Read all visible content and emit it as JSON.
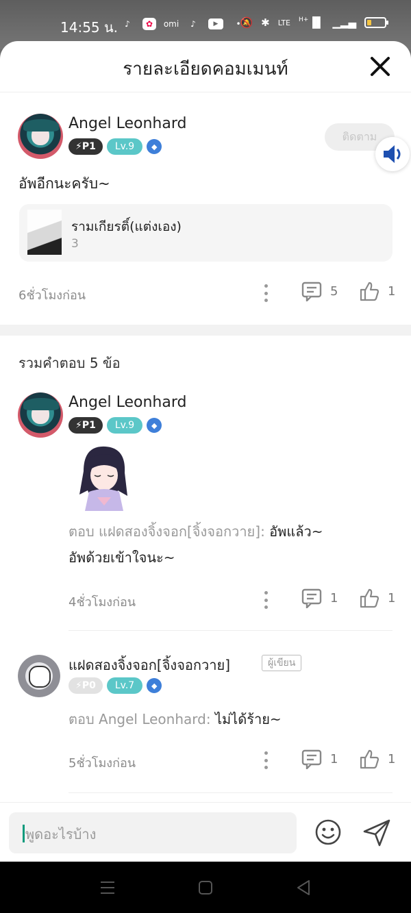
{
  "status_bar": {
    "time": "14:55 น.",
    "app_icons": [
      "music-icon",
      "photos-icon",
      "omi-icon",
      "tiktok-icon",
      "youtube-icon",
      "dot-icon"
    ],
    "omi_label": "omi",
    "network_label": "LTE",
    "net_top": "H+"
  },
  "header": {
    "title": "รายละเอียดคอมเมนท์"
  },
  "post": {
    "user": "Angel Leonhard",
    "badge_p": "P1",
    "badge_lv": "Lv.9",
    "follow_label": "ติดตาม",
    "text": "อัพอีกนะครับ~",
    "quote": {
      "title": "รามเกียรติ์(แต่งเอง)",
      "count": "3"
    },
    "time": "6ชั่วโมงก่อน",
    "comment_count": "5",
    "like_count": "1"
  },
  "replies_title": "รวมคำตอบ 5 ข้อ",
  "replies": [
    {
      "user": "Angel Leonhard",
      "badge_p": "P1",
      "badge_lv": "Lv.9",
      "reply_prefix": "ตอบ แฝดสองจิ้งจอก[จิ้งจอกวาย]: ",
      "reply_text": "อัพแล้ว~",
      "reply_line2": "อัพด้วยเข้าใจนะ~",
      "time": "4ชั่วโมงก่อน",
      "comment_count": "1",
      "like_count": "1"
    },
    {
      "user": "แฝดสองจิ้งจอก[จิ้งจอกวาย]",
      "author_tag": "ผู้เขียน",
      "badge_p": "P0",
      "badge_lv": "Lv.7",
      "reply_prefix": "ตอบ Angel Leonhard: ",
      "reply_text": "ไม่ได้ร้าย~",
      "time": "5ชั่วโมงก่อน",
      "comment_count": "1",
      "like_count": "1"
    }
  ],
  "input": {
    "placeholder": "พูดอะไรบ้าง"
  },
  "colors": {
    "level_badge": "#5bc7c8",
    "gem": "#3e7fd9",
    "caret": "#0a9a7c"
  }
}
